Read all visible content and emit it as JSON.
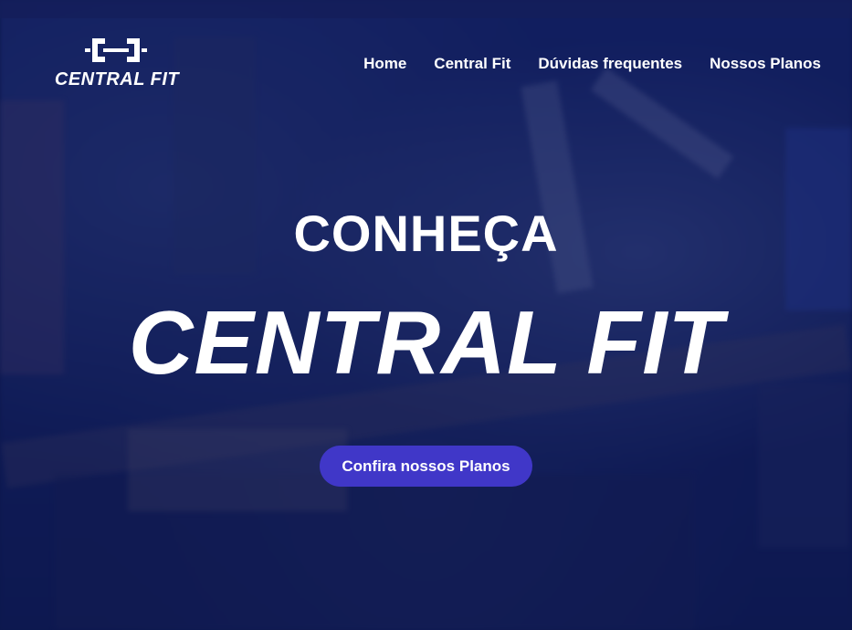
{
  "brand": {
    "name": "CENTRAL FIT",
    "logo_icon": "dumbbell-icon"
  },
  "nav": {
    "items": [
      {
        "label": "Home"
      },
      {
        "label": "Central Fit"
      },
      {
        "label": "Dúvidas frequentes"
      },
      {
        "label": "Nossos Planos"
      }
    ]
  },
  "hero": {
    "kicker": "CONHEÇA",
    "title": "CENTRAL FIT",
    "cta_label": "Confira nossos Planos"
  },
  "colors": {
    "overlay": "#0d1a4f",
    "cta": "#4037c8",
    "text": "#ffffff"
  }
}
